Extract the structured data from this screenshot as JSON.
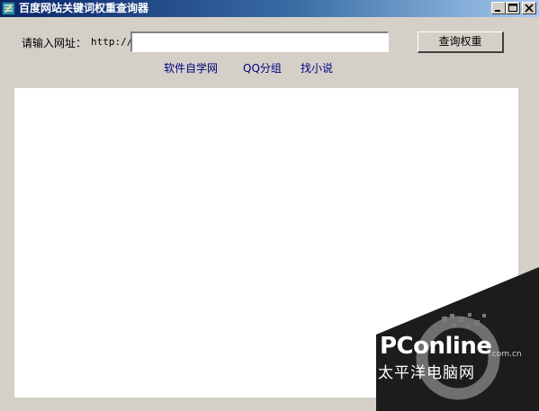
{
  "window": {
    "title": "百度网站关键词权重查询器",
    "icon": "app-icon",
    "controls": [
      "minimize-icon",
      "maximize-icon",
      "close-icon"
    ]
  },
  "form": {
    "label": "请输入网址：",
    "scheme": "http://",
    "url_value": "",
    "button_label": "查询权重"
  },
  "links": [
    "软件自学网",
    "QQ分组",
    "找小说"
  ],
  "watermark": {
    "brand": "PConline",
    "domain": ".com.cn",
    "chinese": "太平洋电脑网"
  },
  "colors": {
    "titlebar_start": "#0a246a",
    "titlebar_end": "#a6caf0",
    "window_bg": "#d4d0c8",
    "link": "#00007e",
    "watermark_bg": "#1c1c1c"
  }
}
